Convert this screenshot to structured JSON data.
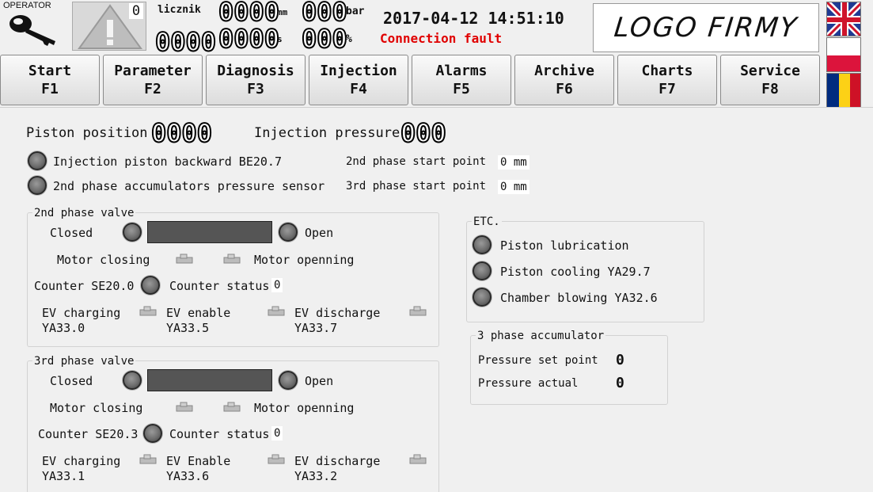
{
  "header": {
    "operator_label": "OPERATOR",
    "warning_count": "0",
    "licznik_label": "licznik",
    "display1": "0000",
    "unit_mm": "mm",
    "display2": "000",
    "unit_bar": "bar",
    "display3": "0000",
    "display4": "0000",
    "unit_s": "s",
    "display5": "000",
    "unit_pct": "%",
    "datetime": "2017-04-12 14:51:10",
    "status": "Connection fault",
    "status_color": "#e00000",
    "logo": "LOGO FIRMY"
  },
  "nav": [
    {
      "label": "Start",
      "key": "F1"
    },
    {
      "label": "Parameter",
      "key": "F2"
    },
    {
      "label": "Diagnosis",
      "key": "F3"
    },
    {
      "label": "Injection",
      "key": "F4"
    },
    {
      "label": "Alarms",
      "key": "F5"
    },
    {
      "label": "Archive",
      "key": "F6"
    },
    {
      "label": "Charts",
      "key": "F7"
    },
    {
      "label": "Service",
      "key": "F8"
    }
  ],
  "languages": [
    "en-flag",
    "pl-flag",
    "ro-flag"
  ],
  "main": {
    "piston_position_label": "Piston position",
    "piston_position_value": "0000",
    "injection_pressure_label": "Injection pressure",
    "injection_pressure_value": "000",
    "lamp1_label": "Injection piston backward BE20.7",
    "lamp2_label": "2nd phase accumulators pressure sensor",
    "phase2_start_label": "2nd phase start point",
    "phase2_start_value": "0 mm",
    "phase3_start_label": "3rd phase start point",
    "phase3_start_value": "0 mm"
  },
  "valve2": {
    "title": "2nd phase valve",
    "closed": "Closed",
    "open": "Open",
    "motor_closing": "Motor closing",
    "motor_opening": "Motor openning",
    "counter_label": "Counter SE20.0",
    "counter_status_label": "Counter status",
    "counter_status_value": "0",
    "ev1_line1": "EV charging",
    "ev1_line2": "YA33.0",
    "ev2_line1": "EV enable",
    "ev2_line2": "YA33.5",
    "ev3_line1": "EV discharge",
    "ev3_line2": "YA33.7"
  },
  "valve3": {
    "title": "3rd phase valve",
    "closed": "Closed",
    "open": "Open",
    "motor_closing": "Motor closing",
    "motor_opening": "Motor openning",
    "counter_label": "Counter SE20.3",
    "counter_status_label": "Counter status",
    "counter_status_value": "0",
    "ev1_line1": "EV charging",
    "ev1_line2": "YA33.1",
    "ev2_line1": "EV Enable",
    "ev2_line2": "YA33.6",
    "ev3_line1": "EV discharge",
    "ev3_line2": "YA33.2"
  },
  "etc": {
    "title": "ETC.",
    "item1": "Piston lubrication",
    "item2": "Piston cooling YA29.7",
    "item3": "Chamber blowing YA32.6"
  },
  "accumulator": {
    "title": "3 phase accumulator",
    "set_point_label": "Pressure set point",
    "set_point_value": "0",
    "actual_label": "Pressure actual",
    "actual_value": "0"
  }
}
